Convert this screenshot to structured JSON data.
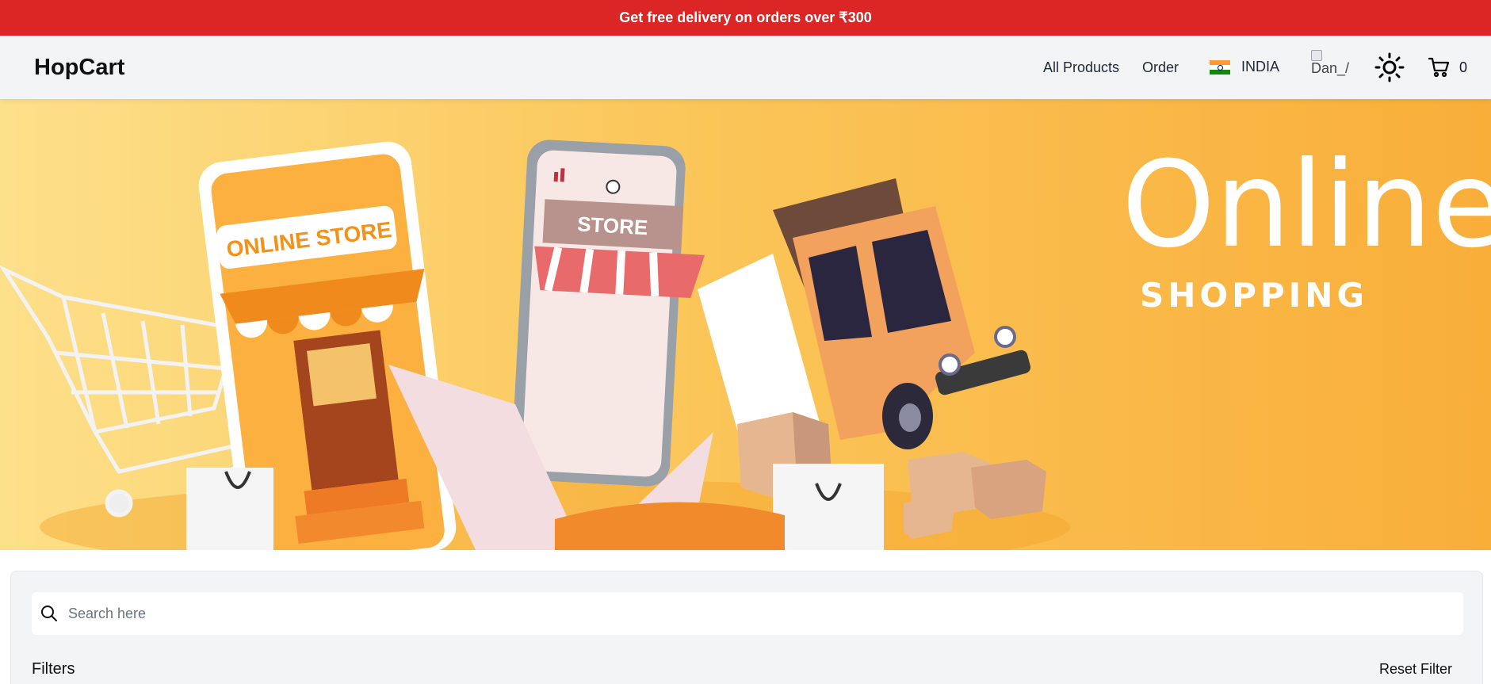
{
  "promo": {
    "text": "Get free delivery on orders over ₹300"
  },
  "navbar": {
    "brand": "HopCart",
    "links": {
      "all_products": "All Products",
      "order": "Order"
    },
    "country": {
      "label": "INDIA",
      "flag_icon": "india-flag-icon"
    },
    "avatar_alt": "Dan_/",
    "theme_icon": "sun-icon",
    "cart": {
      "icon": "cart-icon",
      "count": "0"
    }
  },
  "hero": {
    "headline": "Online.",
    "subheadline": "SHOPPING",
    "sign_store": "ONLINE STORE",
    "phone_sign": "STORE"
  },
  "search": {
    "placeholder": "Search here",
    "value": ""
  },
  "filters": {
    "title": "Filters",
    "reset_label": "Reset Filter"
  },
  "colors": {
    "promo_red": "#dc2626",
    "hero_orange": "#f9ae3a",
    "hero_yellow": "#fde08a"
  }
}
